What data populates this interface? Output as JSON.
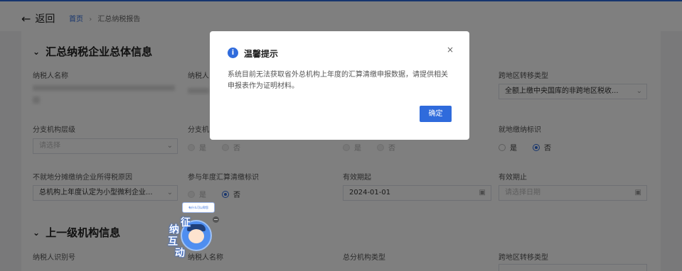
{
  "header": {
    "back_label": "返回",
    "breadcrumb": {
      "home": "首页",
      "separator": "›",
      "current": "汇总纳税报告"
    }
  },
  "section1": {
    "title": "汇总纳税企业总体信息",
    "row1": {
      "name_label": "纳税人名称",
      "id_label": "纳税人",
      "transfer_label": "跨地区转移类型",
      "transfer_value": "全额上缴中央国库的非跨地区税收..."
    },
    "row2": {
      "level_label": "分支机构层级",
      "level_placeholder": "请选择",
      "branch_label": "分支机",
      "yes": "是",
      "no": "否",
      "local_label": "就地缴纳标识",
      "local_yes": "是",
      "local_no": "否"
    },
    "row3": {
      "reason_label": "不就地分摊缴纳企业所得税原因",
      "reason_value": "总机构上年度认定为小型微利企业...",
      "annual_label": "参与年度汇算清缴标识",
      "annual_yes": "是",
      "annual_no": "否",
      "start_label": "有效期起",
      "start_value": "2024-01-01",
      "end_label": "有效期止",
      "end_placeholder": "请选择日期"
    }
  },
  "section2": {
    "title": "上一级机构信息",
    "id_label": "纳税人识别号",
    "name_label": "纳税人名称",
    "type_label": "总分机构类型",
    "transfer_label": "跨地区转移类型"
  },
  "dialog": {
    "title": "温馨提示",
    "message": "系统目前无法获取省外总机构上年度的汇算清缴申报数据，请提供相关申报表作为证明材料。",
    "ok_label": "确定",
    "close_symbol": "×"
  },
  "mascot": {
    "bubble_text": "有什么可以帮您",
    "chars": [
      "征",
      "纳",
      "互",
      "动"
    ]
  },
  "colors": {
    "primary": "#2f6bdc",
    "overlay": "rgba(0,0,0,0.5)"
  },
  "icons": [
    "back-arrow-icon",
    "chevron-down-icon",
    "calendar-icon",
    "info-icon",
    "close-icon"
  ]
}
